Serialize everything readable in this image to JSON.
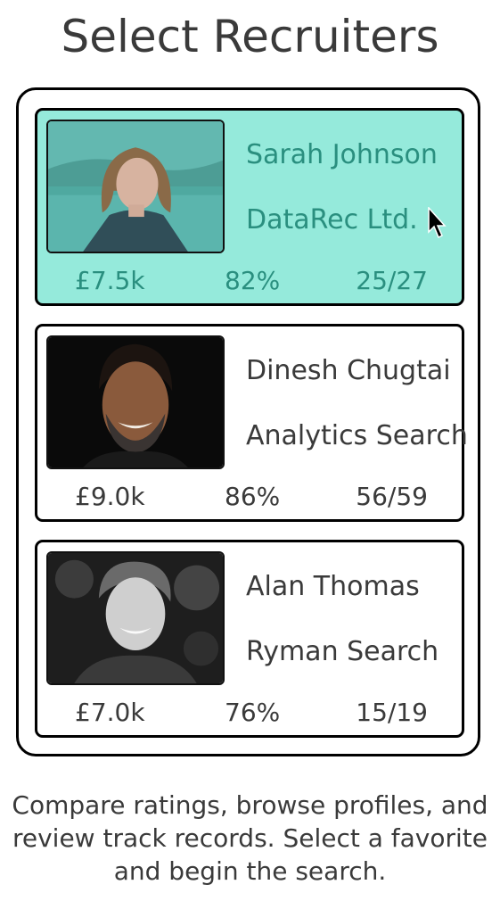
{
  "header": {
    "title": "Select Recruiters"
  },
  "recruiters": [
    {
      "name": "Sarah Johnson",
      "company": "DataRec Ltd.",
      "fee": "£7.5k",
      "rating": "82%",
      "record": "25/27",
      "selected": true
    },
    {
      "name": "Dinesh Chugtai",
      "company": "Analytics Search",
      "fee": "£9.0k",
      "rating": "86%",
      "record": "56/59",
      "selected": false
    },
    {
      "name": "Alan Thomas",
      "company": "Ryman Search",
      "fee": "£7.0k",
      "rating": "76%",
      "record": "15/19",
      "selected": false
    }
  ],
  "caption": "Compare ratings, browse profiles, and review track records. Select a favorite and begin the search.",
  "colors": {
    "selected_bg": "#95eadb",
    "selected_text": "#2a8f7f",
    "border": "#000000"
  },
  "icons": {
    "cursor": "mouse-pointer-icon"
  }
}
